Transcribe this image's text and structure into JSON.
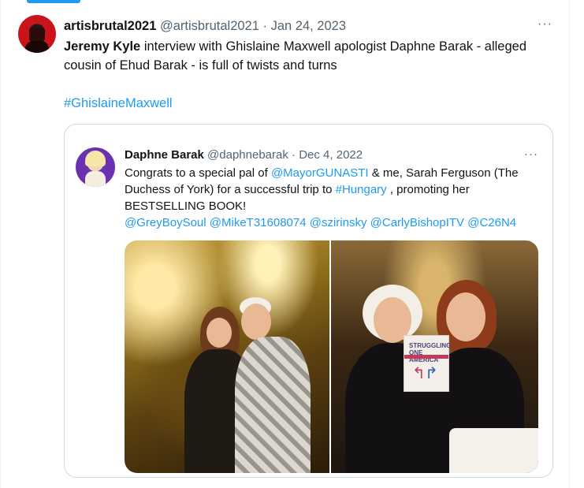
{
  "tweet": {
    "display_name": "artisbrutal2021",
    "handle": "@artisbrutal2021",
    "separator": "·",
    "date": "Jan 24, 2023",
    "more_label": "···",
    "text_bold": "Jeremy Kyle",
    "text_rest": " interview with Ghislaine Maxwell apologist Daphne Barak - alleged cousin of Ehud Barak - is full of twists and turns",
    "hashtag": "#GhislaineMaxwell"
  },
  "quoted_tweet": {
    "display_name": "Daphne Barak",
    "handle": "@daphnebarak",
    "separator": "·",
    "date": "Dec 4, 2022",
    "more_label": "···",
    "text_parts": {
      "p1": "Congrats to a special pal of ",
      "mention1": "@MayorGUNASTI",
      "p2": " & me, Sarah Ferguson (The Duchess of York) for a successful trip to ",
      "hashtag1": "#Hungary",
      "p3": " , promoting her BESTSELLING BOOK!",
      "mentions": "@GreyBoySoul @MikeT31608074 @szirinsky @CarlyBishopITV @C26N4"
    },
    "book_cover_text": "STRUGGLING ONE AMERICA"
  },
  "colors": {
    "link": "#1d9bf0",
    "text": "#0f1419",
    "muted": "#536471",
    "border": "#cfd9de"
  }
}
